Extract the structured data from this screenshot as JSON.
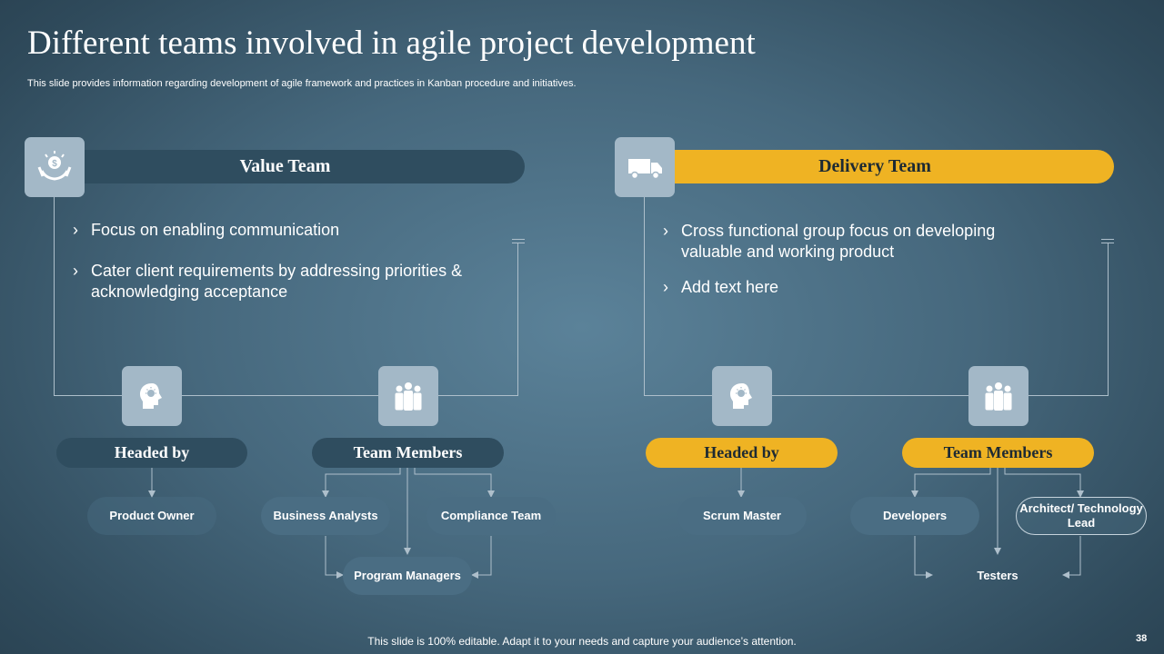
{
  "slide": {
    "title": "Different teams involved in agile project development",
    "subtitle": "This slide provides information regarding development of agile framework and practices in Kanban procedure and initiatives.",
    "footer": "This slide is 100% editable. Adapt it to your needs and capture your audience’s attention.",
    "page_number": "38"
  },
  "value_team": {
    "label": "Value Team",
    "bullets": [
      "Focus on enabling communication",
      "Cater client requirements by addressing priorities & acknowledging acceptance"
    ],
    "headed_by": {
      "label": "Headed by",
      "members": [
        "Product Owner"
      ]
    },
    "team_members": {
      "label": "Team Members",
      "members": [
        "Business Analysts",
        "Compliance Team",
        "Program Managers"
      ]
    }
  },
  "delivery_team": {
    "label": "Delivery Team",
    "bullets": [
      "Cross functional group focus on developing valuable and working product",
      "Add text here"
    ],
    "headed_by": {
      "label": "Headed by",
      "members": [
        "Scrum Master"
      ]
    },
    "team_members": {
      "label": "Team Members",
      "members": [
        "Developers",
        "Architect/ Technology Lead",
        "Testers"
      ]
    }
  },
  "colors": {
    "dark_banner": "#2f4d5f",
    "gold_banner": "#efb323",
    "icon_box": "#a3b8c7"
  },
  "icons": [
    "money-hand-icon",
    "truck-icon",
    "head-idea-icon",
    "team-group-icon"
  ],
  "bullet_glyph": "›"
}
